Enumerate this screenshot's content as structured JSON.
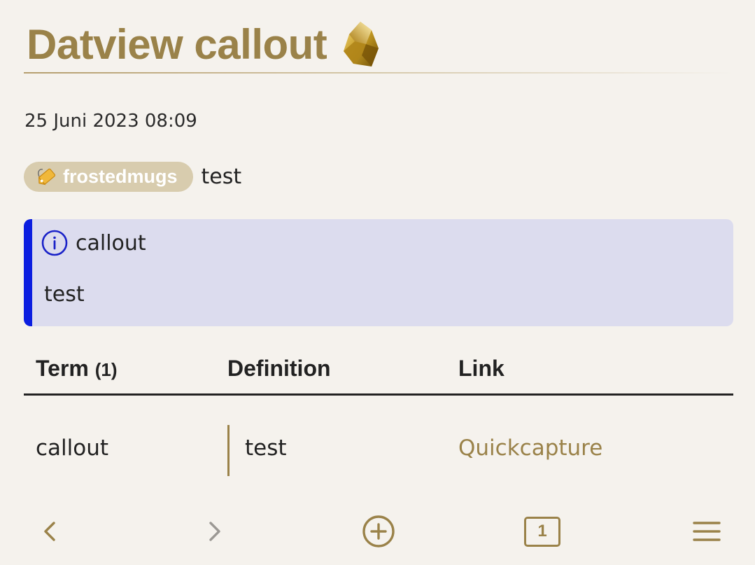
{
  "note": {
    "title": "Datview callout",
    "date": "25 Juni 2023 08:09",
    "tag": {
      "label": "frostedmugs",
      "icon": "tag-label-icon"
    },
    "tag_suffix": "test"
  },
  "callout": {
    "type": "info",
    "icon": "info-circle-icon",
    "title": "callout",
    "body": "test",
    "accent_color": "#0b1ee0",
    "background_color": "#dcdcee"
  },
  "table": {
    "columns": {
      "term": "Term",
      "term_count": "(1)",
      "definition": "Definition",
      "link": "Link"
    },
    "rows": [
      {
        "term": "callout",
        "definition": "test",
        "link": "Quickcapture"
      }
    ]
  },
  "navbar": {
    "items": [
      {
        "name": "back",
        "icon": "chevron-left-icon"
      },
      {
        "name": "forward",
        "icon": "chevron-right-icon"
      },
      {
        "name": "new-note",
        "icon": "plus-circle-icon"
      },
      {
        "name": "tabs",
        "icon": "tab-count-icon",
        "count": "1"
      },
      {
        "name": "menu",
        "icon": "hamburger-menu-icon"
      }
    ]
  },
  "colors": {
    "accent": "#9a8249",
    "background": "#f5f2ed",
    "tag_background": "#d8ccae",
    "text": "#222222"
  }
}
